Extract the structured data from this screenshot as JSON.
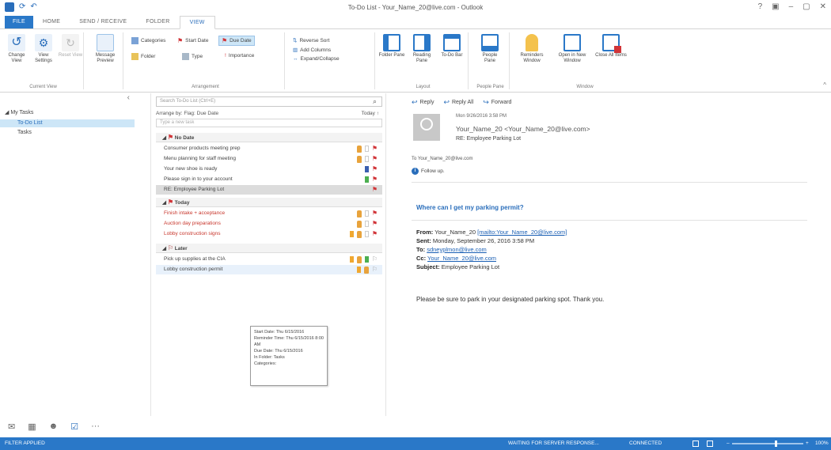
{
  "window": {
    "title": "To-Do List - Your_Name_20@live.com - Outlook",
    "controls": [
      "?",
      "▣",
      "–",
      "▢",
      "✕"
    ]
  },
  "tabs": [
    "FILE",
    "HOME",
    "SEND / RECEIVE",
    "FOLDER",
    "VIEW"
  ],
  "ribbon": {
    "current_view": {
      "label": "Current View",
      "buttons": [
        "Change View",
        "View Settings",
        "Reset View"
      ]
    },
    "message_preview": "Message Preview",
    "arrangement": {
      "label": "Arrangement",
      "items": [
        "Categories",
        "Start Date",
        "Due Date",
        "Folder",
        "Type",
        "Importance"
      ],
      "options": [
        "Reverse Sort",
        "Add Columns",
        "Expand/Collapse"
      ]
    },
    "layout": {
      "label": "Layout",
      "buttons": [
        "Folder Pane",
        "Reading Pane",
        "To-Do Bar"
      ]
    },
    "people_pane": {
      "label": "People Pane",
      "buttons": [
        "People Pane"
      ]
    },
    "window": {
      "label": "Window",
      "buttons": [
        "Reminders Window",
        "Open in New Window",
        "Close All Items"
      ]
    }
  },
  "nav": {
    "group": "My Tasks",
    "items": [
      "To-Do List",
      "Tasks"
    ],
    "bottom_icons": [
      "mail-icon",
      "calendar-icon",
      "people-icon",
      "tasks-icon",
      "more-icon"
    ]
  },
  "tasklist": {
    "search_placeholder": "Search To-Do List (Ctrl+E)",
    "arrange_by": "Arrange by: Flag: Due Date",
    "arrange_right": "Today",
    "new_task_placeholder": "Type a new task",
    "groups": [
      {
        "label": "No Date",
        "tasks": [
          {
            "name": "Consumer products meeting prep",
            "style": "normal"
          },
          {
            "name": "Menu planning for staff meeting",
            "style": "normal"
          },
          {
            "name": "Your new shoe is ready",
            "style": "normal"
          },
          {
            "name": "Please sign in to your account",
            "style": "normal"
          },
          {
            "name": "RE: Employee Parking Lot",
            "style": "selected"
          }
        ]
      },
      {
        "label": "Today",
        "tasks": [
          {
            "name": "Finish intake + acceptance",
            "style": "red"
          },
          {
            "name": "Auction day preparations",
            "style": "red"
          },
          {
            "name": "Lobby construction signs",
            "style": "red"
          }
        ]
      },
      {
        "label": "Later",
        "tasks": [
          {
            "name": "Pick up supplies at the CIA",
            "style": "normal"
          },
          {
            "name": "Lobby construction permit",
            "style": "hover"
          }
        ]
      }
    ],
    "tooltip": [
      "Start Date: Thu 6/15/2016",
      "Reminder Time: Thu 6/15/2016 8:00 AM",
      "Due Date: Thu 6/15/2016",
      "In Folder: Tasks",
      "Categories:"
    ]
  },
  "reading": {
    "actions": [
      "Reply",
      "Reply All",
      "Forward"
    ],
    "date": "Mon 9/26/2016 3:58 PM",
    "from": "Your_Name_20 <Your_Name_20@live.com>",
    "subject": "RE: Employee Parking Lot",
    "to": "To  Your_Name_20@live.com",
    "follow_up": "Follow up.",
    "question": "Where can I get my parking permit?",
    "from_label": "From:",
    "from_value": "Your_Name_20",
    "from_link": "[mailto:Your_Name_20@live.com]",
    "sent_label": "Sent:",
    "sent_value": "Monday, September 26, 2016 3:58 PM",
    "to_label": "To:",
    "to_link": "sdneyplmon@live.com",
    "cc_label": "Cc:",
    "cc_link": "Your_Name_20@live.com",
    "subject_label": "Subject:",
    "subject_value": "Employee Parking Lot",
    "body": "Please be sure to park in your designated parking spot. Thank you."
  },
  "statusbar": {
    "left": "FILTER APPLIED",
    "waiting": "WAITING FOR SERVER RESPONSE...",
    "connected": "CONNECTED",
    "zoom_minus": "–",
    "zoom_plus": "+",
    "zoom_pct": "100%",
    "zoom_level": 0.6
  },
  "colors": {
    "accent": "#2a78c8",
    "flag_red": "#d13438",
    "overdue_text": "#c8372d",
    "selection": "#cde6f7"
  }
}
